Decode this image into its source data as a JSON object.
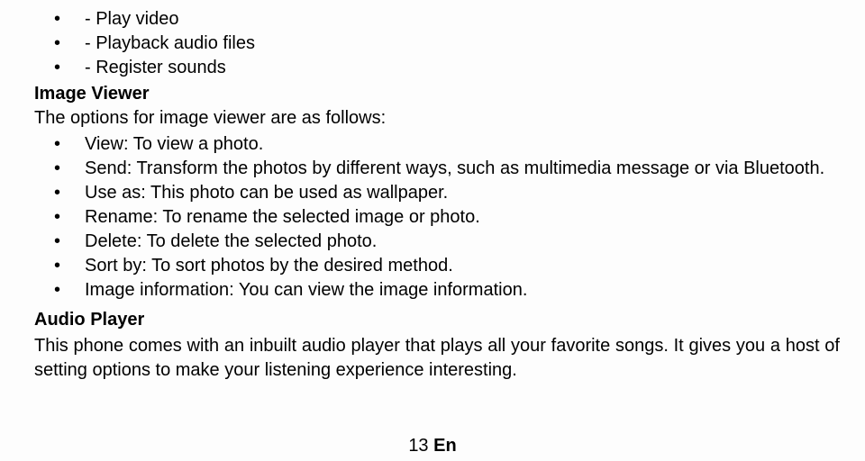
{
  "top_list": {
    "items": [
      "- Play video",
      "- Playback audio files",
      "- Register sounds"
    ]
  },
  "image_viewer": {
    "heading": "Image Viewer",
    "intro": "The options for image viewer are as follows:",
    "items": [
      "View: To view a photo.",
      "Send: Transform the photos by different ways, such as multimedia message or via Bluetooth.",
      "Use as: This photo can be used as wallpaper.",
      "Rename: To rename the selected image or photo.",
      "Delete: To delete the selected photo.",
      "Sort by: To sort photos by the desired method.",
      "Image information: You can view the image information."
    ]
  },
  "audio_player": {
    "heading": "Audio Player",
    "paragraph": "This phone comes with an inbuilt audio player that plays all your favorite songs. It gives you a host of setting options to make your listening experience interesting."
  },
  "footer": {
    "page_number": "13",
    "lang": "En"
  }
}
